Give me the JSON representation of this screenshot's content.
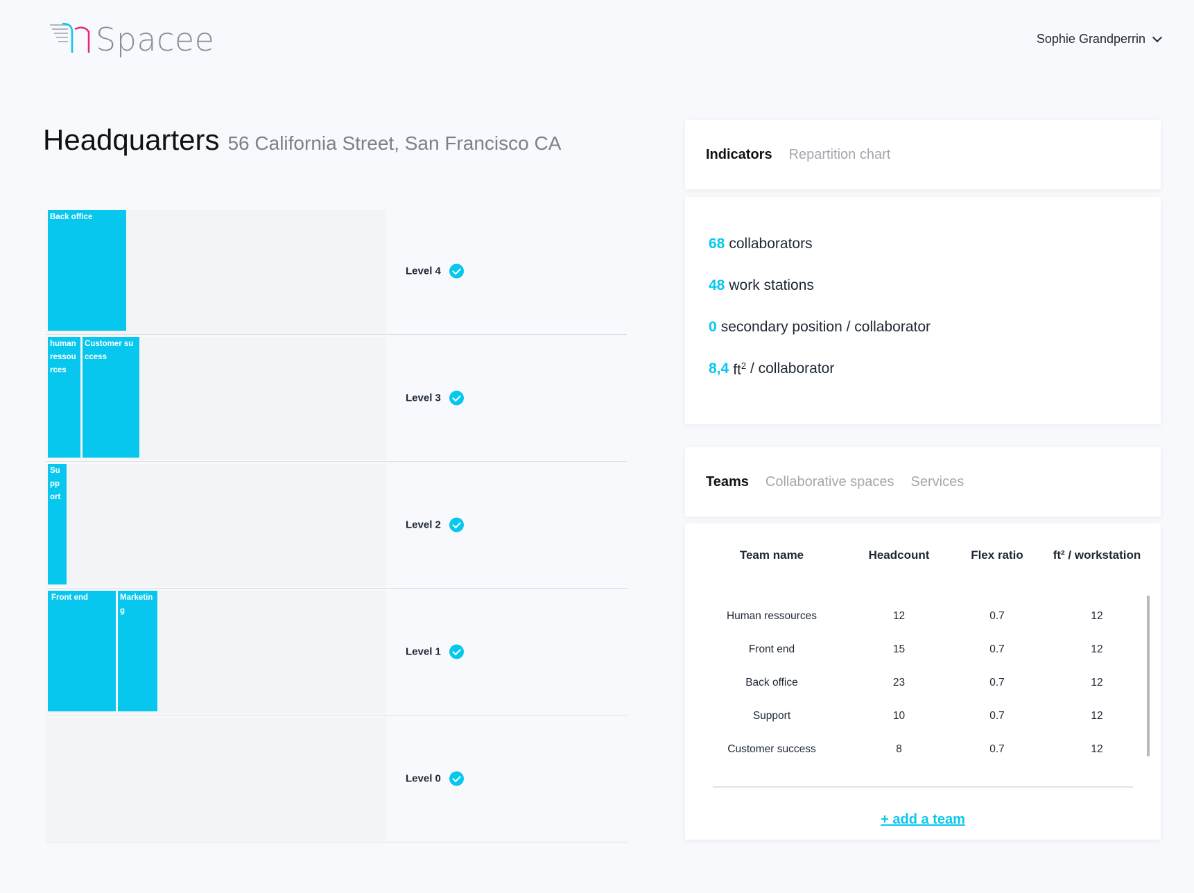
{
  "app": {
    "name": "Spacee"
  },
  "header": {
    "user_name": "Sophie Grandperrin"
  },
  "page": {
    "title": "Headquarters",
    "address": "56 California Street, San Francisco CA"
  },
  "levels": [
    {
      "label": "Level 4",
      "blocks": [
        {
          "name": "Back office"
        }
      ]
    },
    {
      "label": "Level 3",
      "blocks": [
        {
          "name": "human ressources"
        },
        {
          "name": "Customer success"
        }
      ]
    },
    {
      "label": "Level 2",
      "blocks": [
        {
          "name": "Support"
        }
      ]
    },
    {
      "label": "Level 1",
      "blocks": [
        {
          "name": "Front end"
        },
        {
          "name": "Marketing"
        }
      ]
    },
    {
      "label": "Level 0",
      "blocks": []
    }
  ],
  "indicator_tabs": {
    "active": "Indicators",
    "other": "Repartition chart"
  },
  "indicators": {
    "collaborators": {
      "value": "68",
      "label": "collaborators"
    },
    "work_stations": {
      "value": "48",
      "label": "work stations"
    },
    "secondary": {
      "value": "0",
      "label": "secondary position / collaborator"
    },
    "area": {
      "value": "8,4",
      "unit": "ft",
      "sup": "2",
      "label": "/ collaborator"
    }
  },
  "team_tabs": {
    "active": "Teams",
    "tab2": "Collaborative spaces",
    "tab3": "Services"
  },
  "table": {
    "headers": {
      "name": "Team name",
      "headcount": "Headcount",
      "flex": "Flex ratio",
      "ft": "ft² / workstation"
    },
    "rows": [
      {
        "name": "Human ressources",
        "headcount": "12",
        "flex": "0.7",
        "ft": "12"
      },
      {
        "name": "Front end",
        "headcount": "15",
        "flex": "0.7",
        "ft": "12"
      },
      {
        "name": "Back office",
        "headcount": "23",
        "flex": "0.7",
        "ft": "12"
      },
      {
        "name": "Support",
        "headcount": "10",
        "flex": "0.7",
        "ft": "12"
      },
      {
        "name": "Customer success",
        "headcount": "8",
        "flex": "0.7",
        "ft": "12"
      }
    ],
    "add_label": "+ add a team"
  },
  "colors": {
    "accent": "#07c7ef",
    "logo_pink": "#e8237a"
  }
}
